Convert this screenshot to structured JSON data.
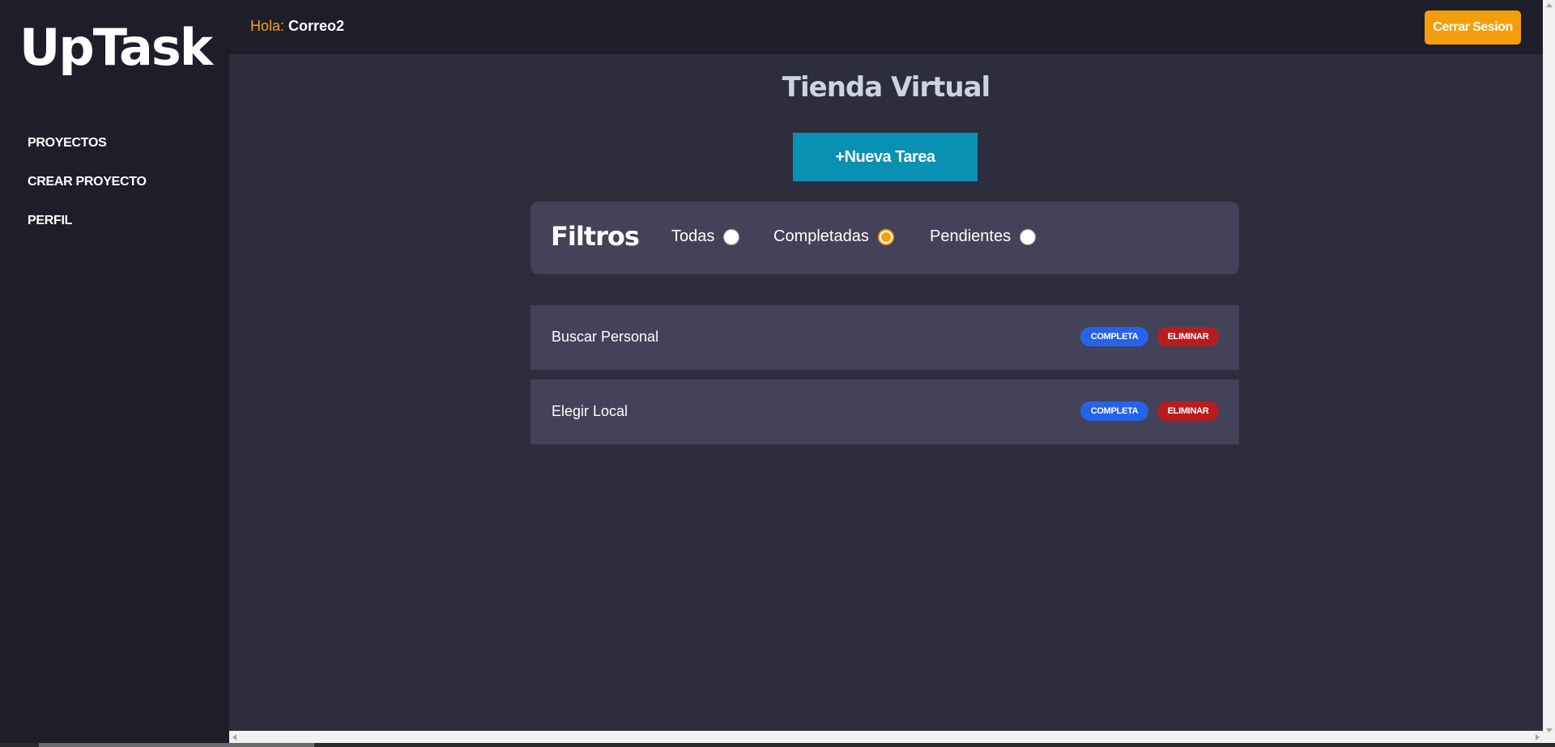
{
  "sidebar": {
    "logo": "UpTask",
    "items": [
      {
        "label": "PROYECTOS"
      },
      {
        "label": "CREAR PROYECTO"
      },
      {
        "label": "PERFIL"
      }
    ]
  },
  "header": {
    "greeting_prefix": "Hola:",
    "username": "Correo2",
    "logout_label": "Cerrar Sesion"
  },
  "project": {
    "title": "Tienda Virtual",
    "new_task_label": "+Nueva Tarea"
  },
  "filters": {
    "title": "Filtros",
    "options": [
      {
        "label": "Todas",
        "checked": false
      },
      {
        "label": "Completadas",
        "checked": true
      },
      {
        "label": "Pendientes",
        "checked": false
      }
    ]
  },
  "tasks": [
    {
      "name": "Buscar Personal",
      "status_label": "COMPLETA",
      "delete_label": "ELIMINAR"
    },
    {
      "name": "Elegir Local",
      "status_label": "COMPLETA",
      "delete_label": "ELIMINAR"
    }
  ],
  "colors": {
    "accent": "#f59e0b",
    "primary": "#0891b2",
    "complete": "#2563eb",
    "delete": "#b91c1c",
    "background": "#2e2d3d",
    "sidebar": "#1e1d2a"
  }
}
